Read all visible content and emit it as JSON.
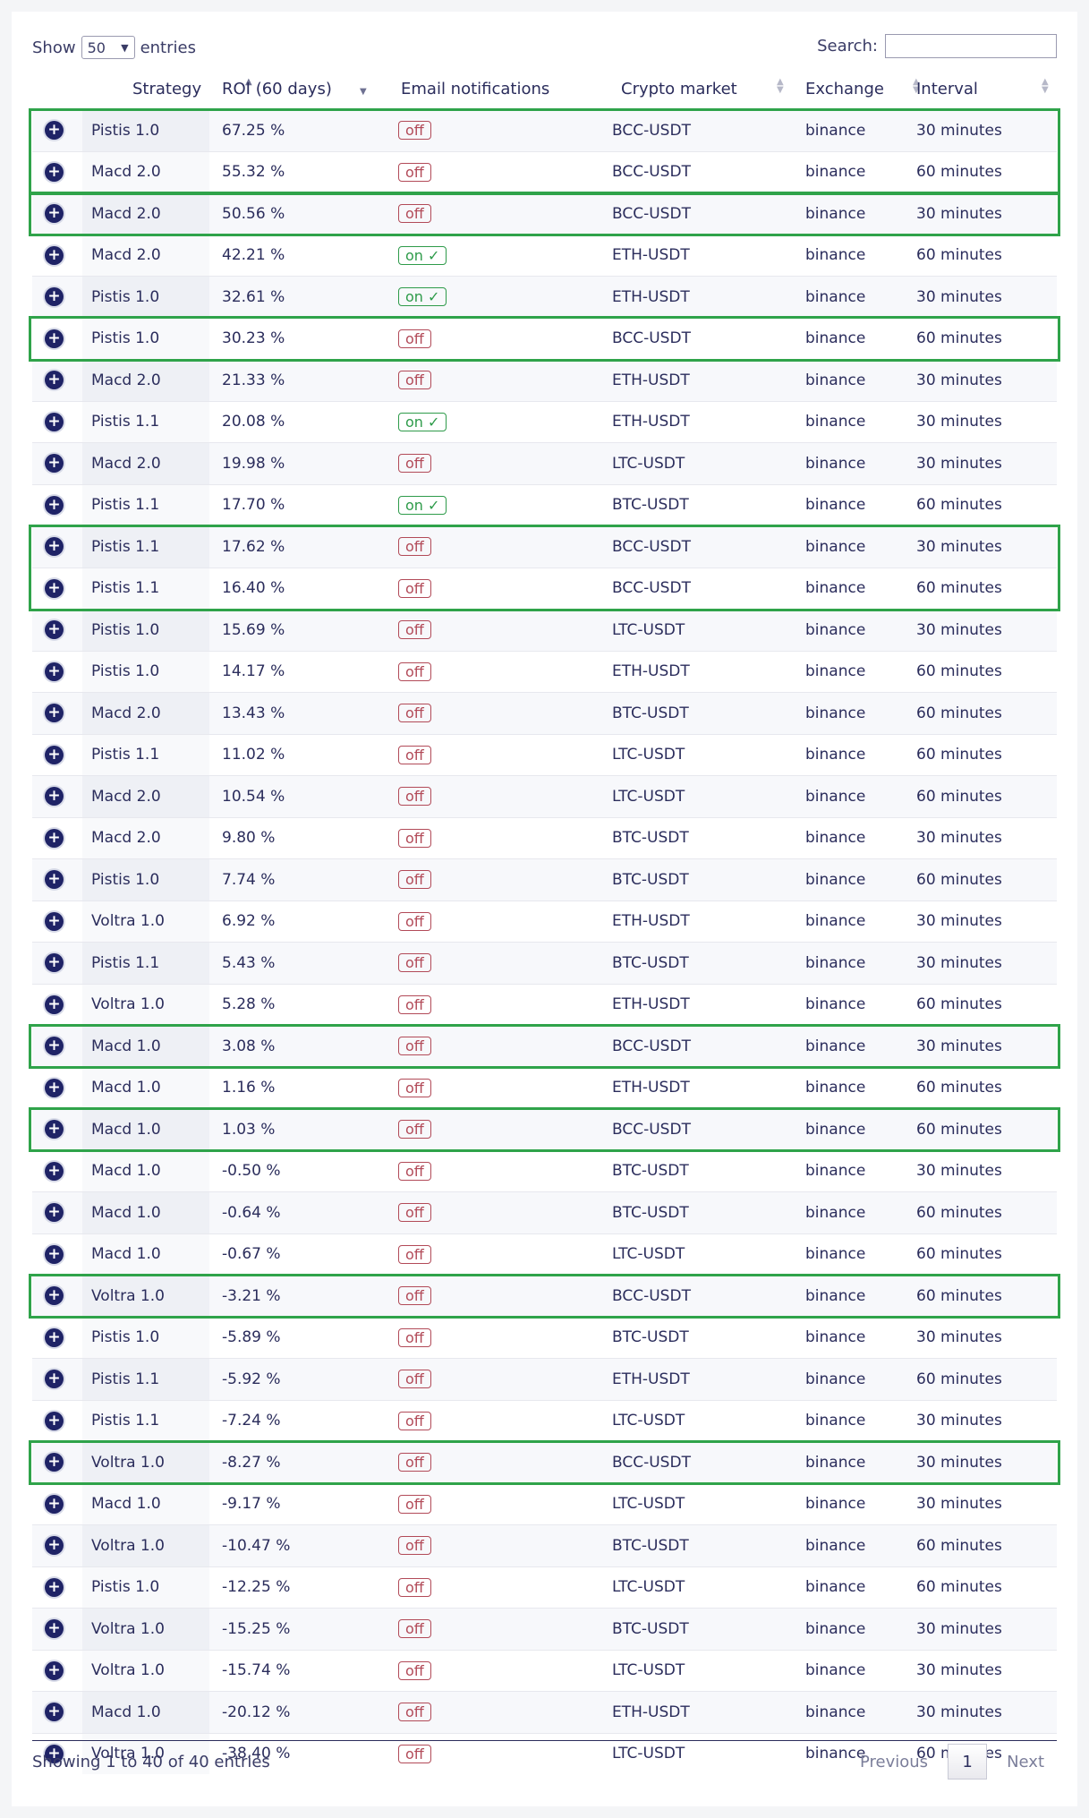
{
  "controls": {
    "show_label": "Show",
    "entries_value": "50",
    "entries_label": "entries",
    "search_label": "Search:",
    "search_value": ""
  },
  "columns": [
    "Strategy",
    "ROI (60 days)",
    "Email notifications",
    "Crypto market",
    "Exchange",
    "Interval"
  ],
  "rows": [
    {
      "strategy": "Pistis 1.0",
      "roi": "67.25 %",
      "email": "off",
      "market": "BCC-USDT",
      "exchange": "binance",
      "interval": "30 minutes",
      "highlighted": true
    },
    {
      "strategy": "Macd 2.0",
      "roi": "55.32 %",
      "email": "off",
      "market": "BCC-USDT",
      "exchange": "binance",
      "interval": "60 minutes",
      "highlighted": true
    },
    {
      "strategy": "Macd 2.0",
      "roi": "50.56 %",
      "email": "off",
      "market": "BCC-USDT",
      "exchange": "binance",
      "interval": "30 minutes",
      "highlighted": true
    },
    {
      "strategy": "Macd 2.0",
      "roi": "42.21 %",
      "email": "on ✓",
      "market": "ETH-USDT",
      "exchange": "binance",
      "interval": "60 minutes",
      "highlighted": false
    },
    {
      "strategy": "Pistis 1.0",
      "roi": "32.61 %",
      "email": "on ✓",
      "market": "ETH-USDT",
      "exchange": "binance",
      "interval": "30 minutes",
      "highlighted": false
    },
    {
      "strategy": "Pistis 1.0",
      "roi": "30.23 %",
      "email": "off",
      "market": "BCC-USDT",
      "exchange": "binance",
      "interval": "60 minutes",
      "highlighted": true
    },
    {
      "strategy": "Macd 2.0",
      "roi": "21.33 %",
      "email": "off",
      "market": "ETH-USDT",
      "exchange": "binance",
      "interval": "30 minutes",
      "highlighted": false
    },
    {
      "strategy": "Pistis 1.1",
      "roi": "20.08 %",
      "email": "on ✓",
      "market": "ETH-USDT",
      "exchange": "binance",
      "interval": "30 minutes",
      "highlighted": false
    },
    {
      "strategy": "Macd 2.0",
      "roi": "19.98 %",
      "email": "off",
      "market": "LTC-USDT",
      "exchange": "binance",
      "interval": "30 minutes",
      "highlighted": false
    },
    {
      "strategy": "Pistis 1.1",
      "roi": "17.70 %",
      "email": "on ✓",
      "market": "BTC-USDT",
      "exchange": "binance",
      "interval": "60 minutes",
      "highlighted": false
    },
    {
      "strategy": "Pistis 1.1",
      "roi": "17.62 %",
      "email": "off",
      "market": "BCC-USDT",
      "exchange": "binance",
      "interval": "30 minutes",
      "highlighted": true
    },
    {
      "strategy": "Pistis 1.1",
      "roi": "16.40 %",
      "email": "off",
      "market": "BCC-USDT",
      "exchange": "binance",
      "interval": "60 minutes",
      "highlighted": true
    },
    {
      "strategy": "Pistis 1.0",
      "roi": "15.69 %",
      "email": "off",
      "market": "LTC-USDT",
      "exchange": "binance",
      "interval": "30 minutes",
      "highlighted": false
    },
    {
      "strategy": "Pistis 1.0",
      "roi": "14.17 %",
      "email": "off",
      "market": "ETH-USDT",
      "exchange": "binance",
      "interval": "60 minutes",
      "highlighted": false
    },
    {
      "strategy": "Macd 2.0",
      "roi": "13.43 %",
      "email": "off",
      "market": "BTC-USDT",
      "exchange": "binance",
      "interval": "60 minutes",
      "highlighted": false
    },
    {
      "strategy": "Pistis 1.1",
      "roi": "11.02 %",
      "email": "off",
      "market": "LTC-USDT",
      "exchange": "binance",
      "interval": "60 minutes",
      "highlighted": false
    },
    {
      "strategy": "Macd 2.0",
      "roi": "10.54 %",
      "email": "off",
      "market": "LTC-USDT",
      "exchange": "binance",
      "interval": "60 minutes",
      "highlighted": false
    },
    {
      "strategy": "Macd 2.0",
      "roi": "9.80 %",
      "email": "off",
      "market": "BTC-USDT",
      "exchange": "binance",
      "interval": "30 minutes",
      "highlighted": false
    },
    {
      "strategy": "Pistis 1.0",
      "roi": "7.74 %",
      "email": "off",
      "market": "BTC-USDT",
      "exchange": "binance",
      "interval": "60 minutes",
      "highlighted": false
    },
    {
      "strategy": "Voltra 1.0",
      "roi": "6.92 %",
      "email": "off",
      "market": "ETH-USDT",
      "exchange": "binance",
      "interval": "30 minutes",
      "highlighted": false
    },
    {
      "strategy": "Pistis 1.1",
      "roi": "5.43 %",
      "email": "off",
      "market": "BTC-USDT",
      "exchange": "binance",
      "interval": "30 minutes",
      "highlighted": false
    },
    {
      "strategy": "Voltra 1.0",
      "roi": "5.28 %",
      "email": "off",
      "market": "ETH-USDT",
      "exchange": "binance",
      "interval": "60 minutes",
      "highlighted": false
    },
    {
      "strategy": "Macd 1.0",
      "roi": "3.08 %",
      "email": "off",
      "market": "BCC-USDT",
      "exchange": "binance",
      "interval": "30 minutes",
      "highlighted": true
    },
    {
      "strategy": "Macd 1.0",
      "roi": "1.16 %",
      "email": "off",
      "market": "ETH-USDT",
      "exchange": "binance",
      "interval": "60 minutes",
      "highlighted": false
    },
    {
      "strategy": "Macd 1.0",
      "roi": "1.03 %",
      "email": "off",
      "market": "BCC-USDT",
      "exchange": "binance",
      "interval": "60 minutes",
      "highlighted": true
    },
    {
      "strategy": "Macd 1.0",
      "roi": "-0.50 %",
      "email": "off",
      "market": "BTC-USDT",
      "exchange": "binance",
      "interval": "30 minutes",
      "highlighted": false
    },
    {
      "strategy": "Macd 1.0",
      "roi": "-0.64 %",
      "email": "off",
      "market": "BTC-USDT",
      "exchange": "binance",
      "interval": "60 minutes",
      "highlighted": false
    },
    {
      "strategy": "Macd 1.0",
      "roi": "-0.67 %",
      "email": "off",
      "market": "LTC-USDT",
      "exchange": "binance",
      "interval": "60 minutes",
      "highlighted": false
    },
    {
      "strategy": "Voltra 1.0",
      "roi": "-3.21 %",
      "email": "off",
      "market": "BCC-USDT",
      "exchange": "binance",
      "interval": "60 minutes",
      "highlighted": true
    },
    {
      "strategy": "Pistis 1.0",
      "roi": "-5.89 %",
      "email": "off",
      "market": "BTC-USDT",
      "exchange": "binance",
      "interval": "30 minutes",
      "highlighted": false
    },
    {
      "strategy": "Pistis 1.1",
      "roi": "-5.92 %",
      "email": "off",
      "market": "ETH-USDT",
      "exchange": "binance",
      "interval": "60 minutes",
      "highlighted": false
    },
    {
      "strategy": "Pistis 1.1",
      "roi": "-7.24 %",
      "email": "off",
      "market": "LTC-USDT",
      "exchange": "binance",
      "interval": "30 minutes",
      "highlighted": false
    },
    {
      "strategy": "Voltra 1.0",
      "roi": "-8.27 %",
      "email": "off",
      "market": "BCC-USDT",
      "exchange": "binance",
      "interval": "30 minutes",
      "highlighted": true
    },
    {
      "strategy": "Macd 1.0",
      "roi": "-9.17 %",
      "email": "off",
      "market": "LTC-USDT",
      "exchange": "binance",
      "interval": "30 minutes",
      "highlighted": false
    },
    {
      "strategy": "Voltra 1.0",
      "roi": "-10.47 %",
      "email": "off",
      "market": "BTC-USDT",
      "exchange": "binance",
      "interval": "60 minutes",
      "highlighted": false
    },
    {
      "strategy": "Pistis 1.0",
      "roi": "-12.25 %",
      "email": "off",
      "market": "LTC-USDT",
      "exchange": "binance",
      "interval": "60 minutes",
      "highlighted": false
    },
    {
      "strategy": "Voltra 1.0",
      "roi": "-15.25 %",
      "email": "off",
      "market": "BTC-USDT",
      "exchange": "binance",
      "interval": "30 minutes",
      "highlighted": false
    },
    {
      "strategy": "Voltra 1.0",
      "roi": "-15.74 %",
      "email": "off",
      "market": "LTC-USDT",
      "exchange": "binance",
      "interval": "30 minutes",
      "highlighted": false
    },
    {
      "strategy": "Macd 1.0",
      "roi": "-20.12 %",
      "email": "off",
      "market": "ETH-USDT",
      "exchange": "binance",
      "interval": "30 minutes",
      "highlighted": false
    },
    {
      "strategy": "Voltra 1.0",
      "roi": "-38.40 %",
      "email": "off",
      "market": "LTC-USDT",
      "exchange": "binance",
      "interval": "60 minutes",
      "highlighted": false
    }
  ],
  "footer": {
    "info": "Showing 1 to 40 of 40 entries",
    "previous": "Previous",
    "current_page": "1",
    "next": "Next"
  },
  "colors": {
    "highlight_border": "#2fa34a",
    "off_badge": "#b24a58",
    "on_badge": "#2e9b4a",
    "expand_button": "#1f2366"
  }
}
